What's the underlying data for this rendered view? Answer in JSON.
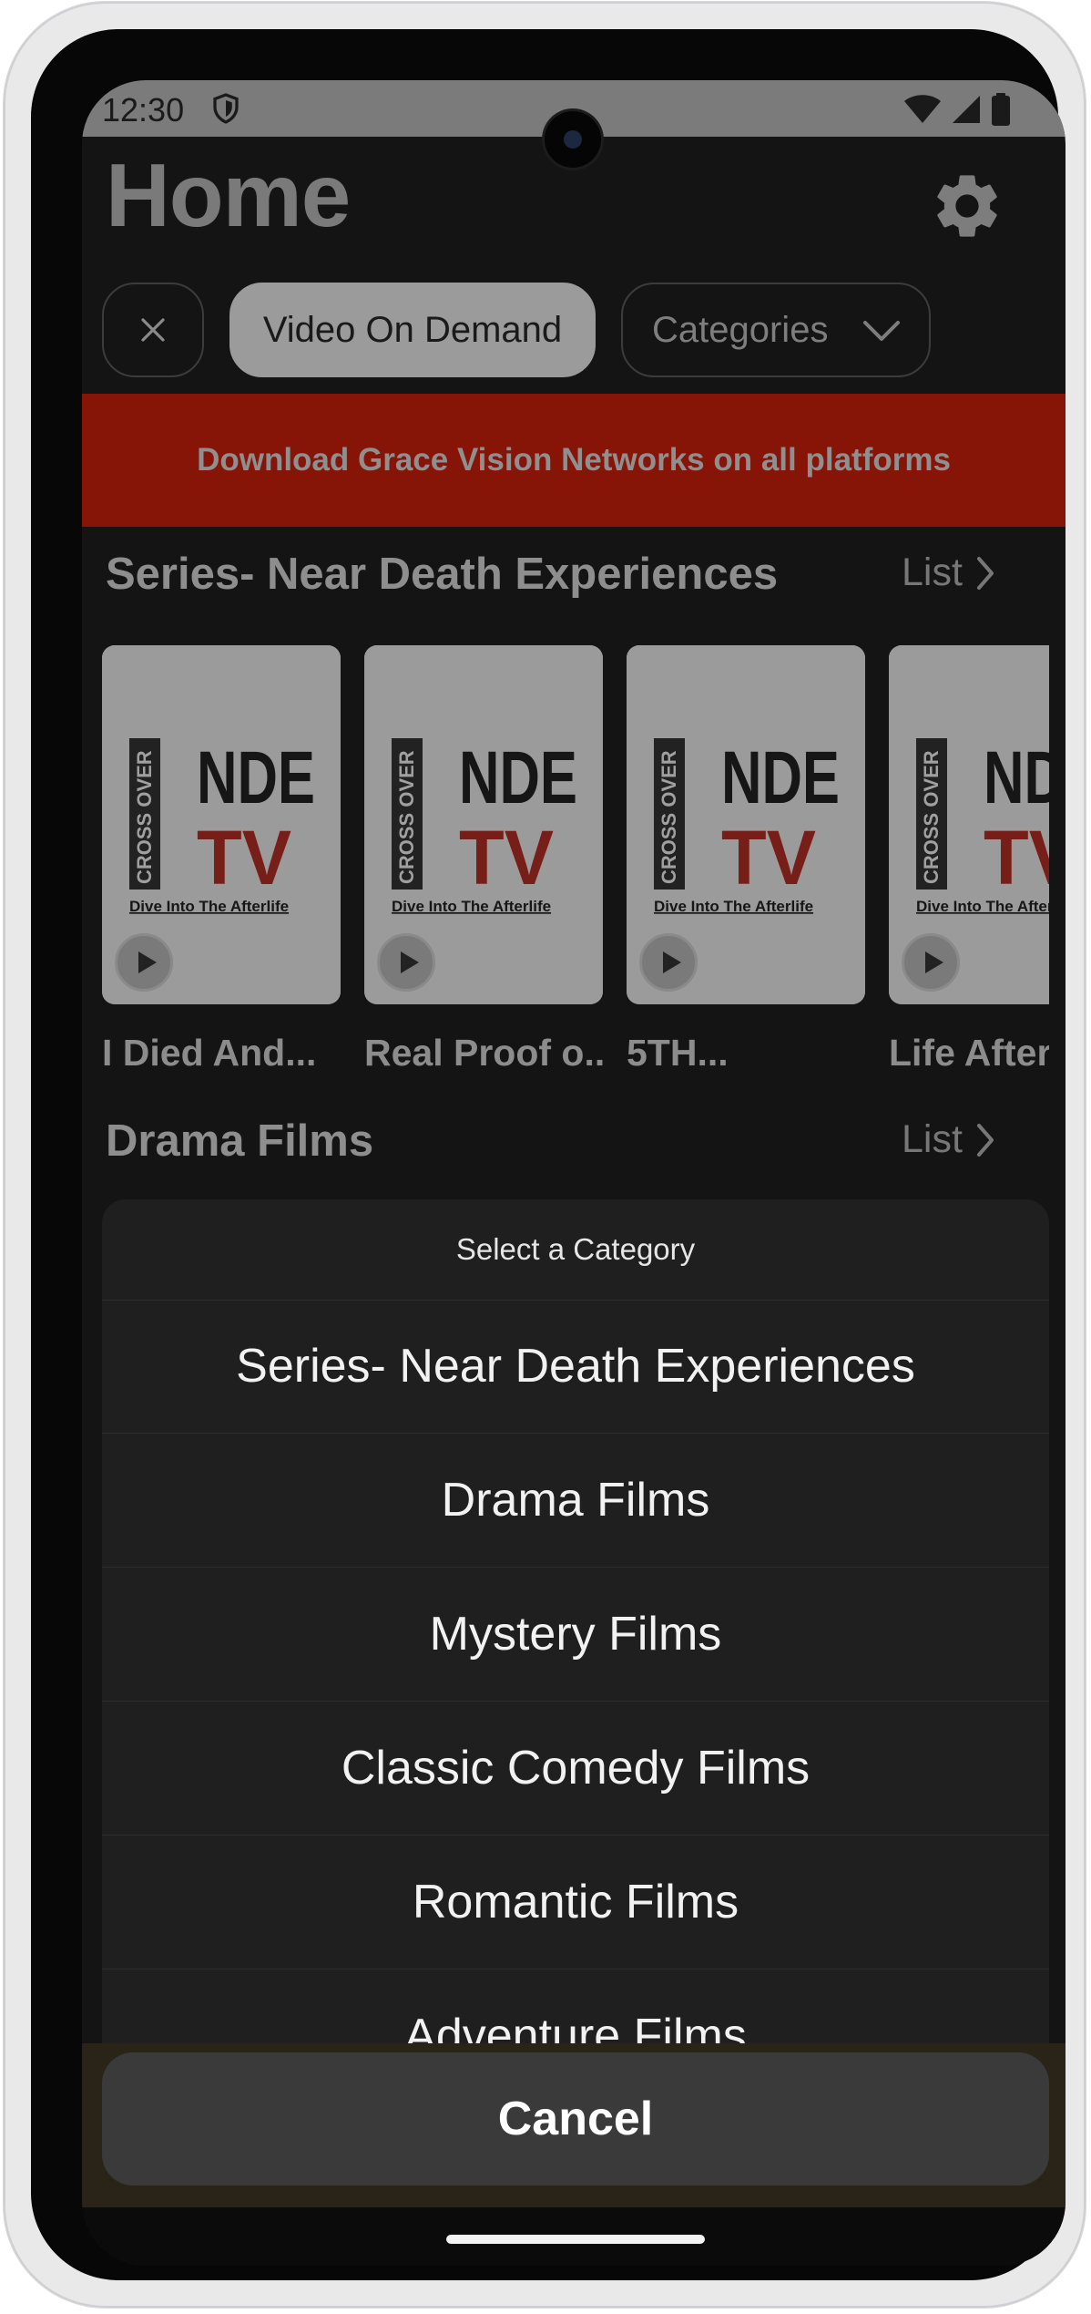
{
  "status_bar": {
    "time": "12:30",
    "icons": [
      "shield-icon",
      "wifi-icon",
      "signal-icon",
      "battery-icon"
    ]
  },
  "header": {
    "title": "Home",
    "settings_icon": "gear-icon"
  },
  "filters": {
    "clear_icon": "close-icon",
    "selected_chip": "Video On Demand",
    "categories_chip": "Categories",
    "categories_icon": "chevron-down-icon"
  },
  "banner": {
    "text": "Download Grace Vision Networks on all platforms",
    "color": "#861508"
  },
  "sections": [
    {
      "title": "Series- Near Death Experiences",
      "list_label": "List",
      "items": [
        {
          "title": "I Died And...",
          "poster": {
            "side": "CROSS OVER",
            "top": "NDE",
            "bottom": "TV",
            "tagline": "Dive Into The Afterlife"
          }
        },
        {
          "title": "Real Proof o...",
          "poster": {
            "side": "CROSS OVER",
            "top": "NDE",
            "bottom": "TV",
            "tagline": "Dive Into The Afterlife"
          }
        },
        {
          "title": "5TH...",
          "poster": {
            "side": "CROSS OVER",
            "top": "NDE",
            "bottom": "TV",
            "tagline": "Dive Into The Afterlife"
          }
        },
        {
          "title": "Life After",
          "poster": {
            "side": "CROSS OVER",
            "top": "NDE",
            "bottom": "TV",
            "tagline": "Dive Into The Afterlife"
          }
        }
      ]
    },
    {
      "title": "Drama Films",
      "list_label": "List"
    }
  ],
  "category_sheet": {
    "title": "Select a Category",
    "options": [
      "Series- Near Death Experiences",
      "Drama Films",
      "Mystery Films",
      "Classic Comedy Films",
      "Romantic Films",
      "Adventure Films"
    ],
    "cancel_label": "Cancel"
  },
  "colors": {
    "background": "#141414",
    "accent_red": "#8b1a12",
    "sheet": "#1f1f1f"
  }
}
